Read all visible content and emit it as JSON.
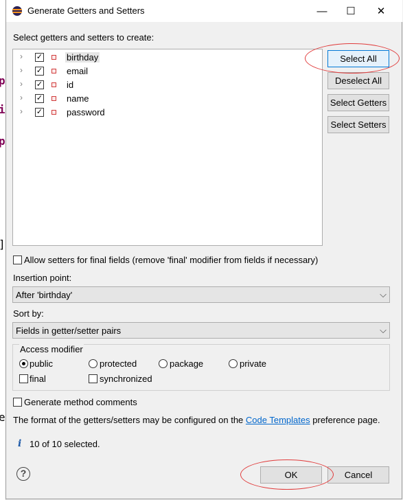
{
  "window": {
    "title": "Generate Getters and Setters",
    "minimize_glyph": "—",
    "maximize_glyph": "☐",
    "close_glyph": "✕"
  },
  "background_editor": {
    "glyphs": [
      "p",
      "i",
      "p",
      "]",
      "e"
    ]
  },
  "fields_label": "Select getters and setters to create:",
  "fields": [
    {
      "name": "birthday",
      "checked": true,
      "selected": true
    },
    {
      "name": "email",
      "checked": true,
      "selected": false
    },
    {
      "name": "id",
      "checked": true,
      "selected": false
    },
    {
      "name": "name",
      "checked": true,
      "selected": false
    },
    {
      "name": "password",
      "checked": true,
      "selected": false
    }
  ],
  "side_buttons": {
    "select_all": "Select All",
    "deselect_all": "Deselect All",
    "select_getters": "Select Getters",
    "select_setters": "Select Setters"
  },
  "allow_setters_final": {
    "label": "Allow setters for final fields (remove 'final' modifier from fields if necessary)",
    "checked": false
  },
  "insertion_point": {
    "label": "Insertion point:",
    "value": "After 'birthday'"
  },
  "sort_by": {
    "label": "Sort by:",
    "value": "Fields in getter/setter pairs"
  },
  "access_modifier": {
    "title": "Access modifier",
    "options": [
      {
        "label": "public",
        "selected": true
      },
      {
        "label": "protected",
        "selected": false
      },
      {
        "label": "package",
        "selected": false
      },
      {
        "label": "private",
        "selected": false
      }
    ],
    "final": {
      "label": "final",
      "checked": false
    },
    "synchronized": {
      "label": "synchronized",
      "checked": false
    }
  },
  "generate_comments": {
    "label": "Generate method comments",
    "checked": false
  },
  "templates_note": {
    "prefix": "The format of the getters/setters may be configured on the",
    "link": "Code Templates",
    "suffix": "preference page."
  },
  "status": {
    "icon": "info-icon",
    "text": "10 of 10 selected."
  },
  "footer": {
    "ok": "OK",
    "cancel": "Cancel",
    "help_glyph": "?"
  },
  "colors": {
    "annotation": "#e03a3a",
    "link": "#0066cc",
    "focus": "#0078d7"
  }
}
